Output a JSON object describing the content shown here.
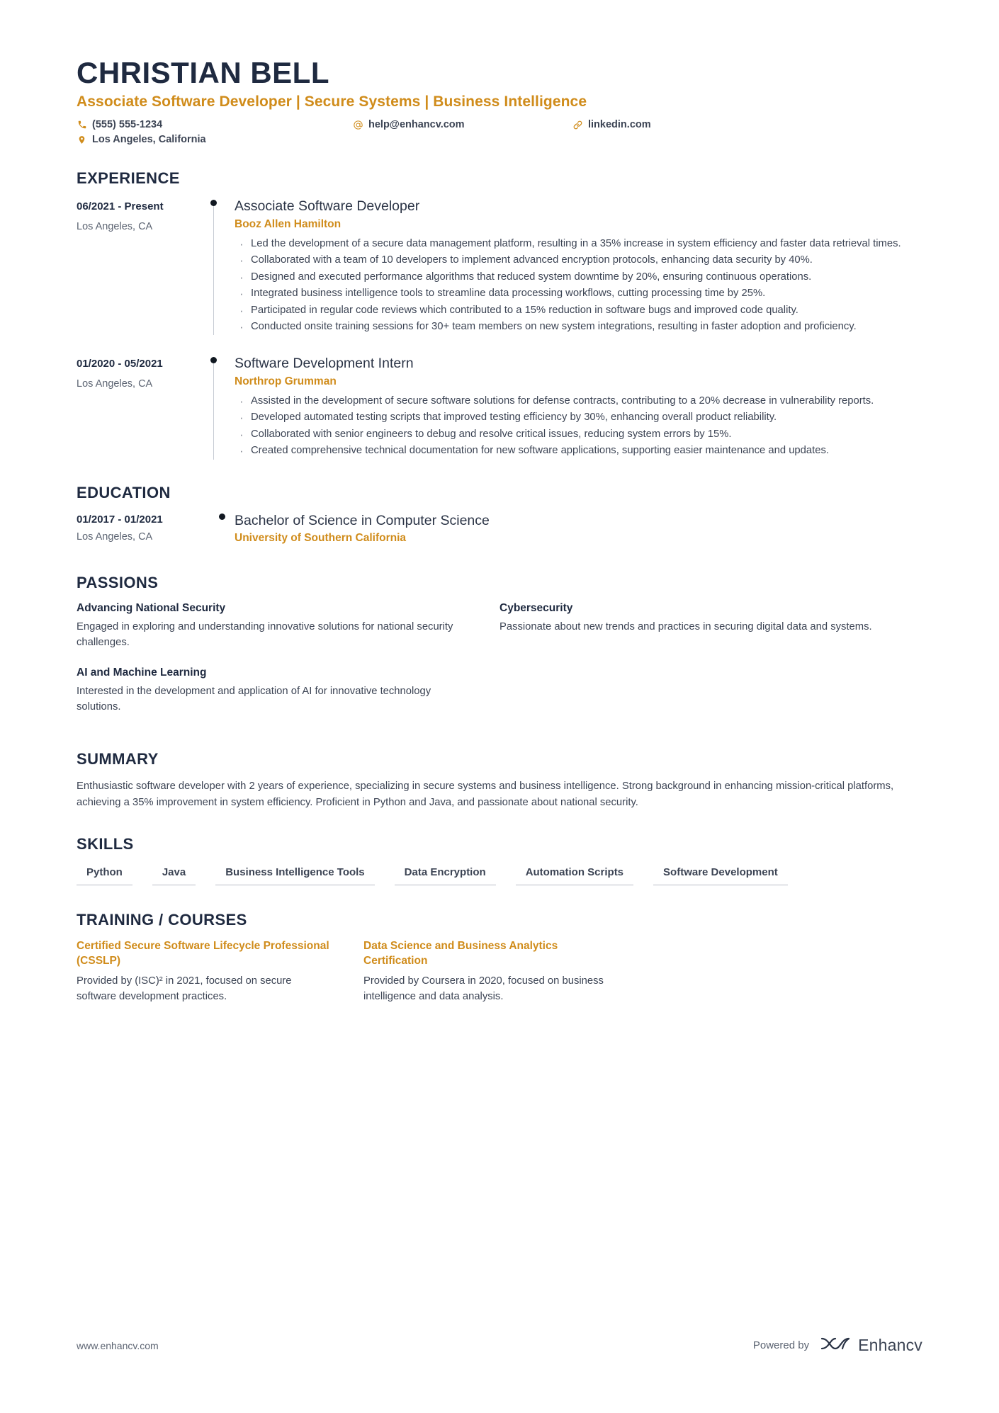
{
  "header": {
    "name": "CHRISTIAN BELL",
    "headline": "Associate Software Developer | Secure Systems | Business Intelligence",
    "contacts": {
      "phone": "(555) 555-1234",
      "email": "help@enhancv.com",
      "link": "linkedin.com",
      "location": "Los Angeles, California"
    }
  },
  "sections": {
    "experience_title": "EXPERIENCE",
    "education_title": "EDUCATION",
    "passions_title": "PASSIONS",
    "summary_title": "SUMMARY",
    "skills_title": "SKILLS",
    "training_title": "TRAINING / COURSES"
  },
  "experience": [
    {
      "dates": "06/2021 - Present",
      "location": "Los Angeles, CA",
      "role": "Associate Software Developer",
      "org": "Booz Allen Hamilton",
      "bullets": [
        "Led the development of a secure data management platform, resulting in a 35% increase in system efficiency and faster data retrieval times.",
        "Collaborated with a team of 10 developers to implement advanced encryption protocols, enhancing data security by 40%.",
        "Designed and executed performance algorithms that reduced system downtime by 20%, ensuring continuous operations.",
        "Integrated business intelligence tools to streamline data processing workflows, cutting processing time by 25%.",
        "Participated in regular code reviews which contributed to a 15% reduction in software bugs and improved code quality.",
        "Conducted onsite training sessions for 30+ team members on new system integrations, resulting in faster adoption and proficiency."
      ]
    },
    {
      "dates": "01/2020 - 05/2021",
      "location": "Los Angeles, CA",
      "role": "Software Development Intern",
      "org": "Northrop Grumman",
      "bullets": [
        "Assisted in the development of secure software solutions for defense contracts, contributing to a 20% decrease in vulnerability reports.",
        "Developed automated testing scripts that improved testing efficiency by 30%, enhancing overall product reliability.",
        "Collaborated with senior engineers to debug and resolve critical issues, reducing system errors by 15%.",
        "Created comprehensive technical documentation for new software applications, supporting easier maintenance and updates."
      ]
    }
  ],
  "education": [
    {
      "dates": "01/2017 - 01/2021",
      "location": "Los Angeles, CA",
      "degree": "Bachelor of Science in Computer Science",
      "school": "University of Southern California"
    }
  ],
  "passions": [
    {
      "title": "Advancing National Security",
      "text": "Engaged in exploring and understanding innovative solutions for national security challenges."
    },
    {
      "title": "Cybersecurity",
      "text": "Passionate about new trends and practices in securing digital data and systems."
    },
    {
      "title": "AI and Machine Learning",
      "text": "Interested in the development and application of AI for innovative technology solutions."
    }
  ],
  "summary": {
    "text": "Enthusiastic software developer with 2 years of experience, specializing in secure systems and business intelligence. Strong background in enhancing mission-critical platforms, achieving a 35% improvement in system efficiency. Proficient in Python and Java, and passionate about national security."
  },
  "skills": [
    "Python",
    "Java",
    "Business Intelligence Tools",
    "Data Encryption",
    "Automation Scripts",
    "Software Development"
  ],
  "training": [
    {
      "title": "Certified Secure Software Lifecycle Professional (CSSLP)",
      "text": "Provided by (ISC)² in 2021, focused on secure software development practices."
    },
    {
      "title": "Data Science and Business Analytics Certification",
      "text": "Provided by Coursera in 2020, focused on business intelligence and data analysis."
    }
  ],
  "footer": {
    "url": "www.enhancv.com",
    "powered_by": "Powered by",
    "brand": "Enhancv"
  },
  "colors": {
    "accent": "#d08c1b",
    "heading": "#1f2a40",
    "body": "#3c4454",
    "muted": "#5c6472",
    "rule": "#b9bec7"
  }
}
